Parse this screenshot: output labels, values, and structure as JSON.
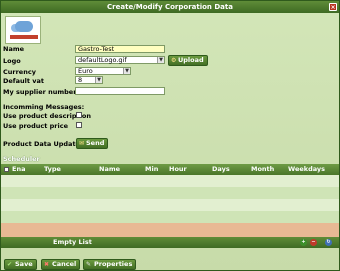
{
  "window": {
    "title": "Create/Modify Corporation Data",
    "close_label": "×"
  },
  "form": {
    "name_label": "Name",
    "name_value": "Gastro-Test",
    "logo_label": "Logo",
    "logo_value": "defaultLogo.gif",
    "upload_label": "Upload",
    "currency_label": "Currency",
    "currency_value": "Euro",
    "vat_label": "Default vat",
    "vat_value": "8",
    "supplier_label": "My supplier number",
    "supplier_value": "",
    "incoming_label": "Incomming Messages:",
    "use_desc_label": "Use product description",
    "use_price_label": "Use product price",
    "updates_label": "Product Data Updates",
    "send_label": "Send"
  },
  "scheduler": {
    "title": "Scheduler",
    "columns": [
      "Ena",
      "Type",
      "Name",
      "Min",
      "Hour",
      "Days",
      "Month",
      "Weekdays"
    ],
    "empty_text": "Empty List",
    "row_colors": [
      "#e2efd0",
      "#cfe4b6",
      "#e2efd0",
      "#cfe4b6",
      "#e2efd0",
      "#e8b994"
    ]
  },
  "footer": {
    "save_label": "Save",
    "cancel_label": "Cancel",
    "properties_label": "Properties"
  },
  "colors": {
    "title_bar": "#4a7629",
    "accent_highlight": "#ffffc0",
    "cancel_red": "#c0392b"
  }
}
